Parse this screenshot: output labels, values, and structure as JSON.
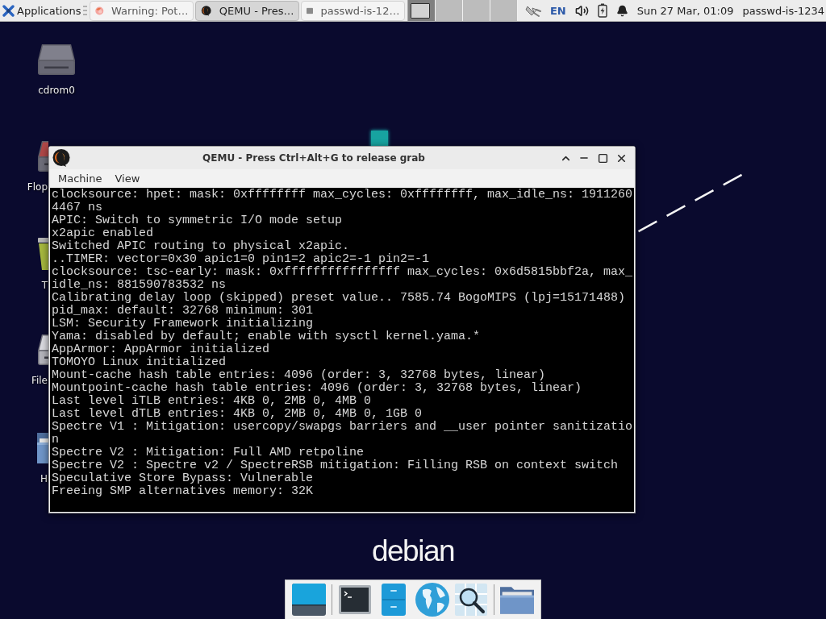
{
  "top_panel": {
    "applications_menu": {
      "label": "Applications"
    },
    "tasks": [
      {
        "kind": "browser",
        "label": "Warning: Pot…",
        "selected": false
      },
      {
        "kind": "qemu",
        "label": "QEMU - Pres…",
        "selected": true
      },
      {
        "kind": "terminal",
        "label": "passwd-is-12…",
        "selected": false
      }
    ],
    "workspaces": [
      {
        "selected": true,
        "has_window": true
      },
      {
        "selected": false,
        "has_window": false
      },
      {
        "selected": false,
        "has_window": false
      },
      {
        "selected": false,
        "has_window": false
      }
    ],
    "tray": [
      {
        "kind": "network"
      },
      {
        "kind": "keyboard-layout",
        "label": "EN"
      },
      {
        "kind": "volume"
      },
      {
        "kind": "battery"
      },
      {
        "kind": "notifications"
      },
      {
        "kind": "clock",
        "label": "Sun 27 Mar, 01:09"
      },
      {
        "kind": "user",
        "label": "passwd-is-1234"
      }
    ]
  },
  "desktop_icons": [
    {
      "kind": "optical-drive",
      "label": "cdrom0"
    },
    {
      "kind": "floppy",
      "label": "Flop"
    },
    {
      "kind": "trash",
      "label": "T"
    },
    {
      "kind": "drive",
      "label": "File"
    },
    {
      "kind": "home",
      "label": "H"
    }
  ],
  "qemu_window": {
    "title": "QEMU - Press Ctrl+Alt+G to release grab",
    "menu": [
      "Machine",
      "View"
    ],
    "console_lines": [
      "clocksource: hpet: mask: 0xffffffff max_cycles: 0xffffffff, max_idle_ns: 1911260",
      "4467 ns",
      "APIC: Switch to symmetric I/O mode setup",
      "x2apic enabled",
      "Switched APIC routing to physical x2apic.",
      "..TIMER: vector=0x30 apic1=0 pin1=2 apic2=-1 pin2=-1",
      "clocksource: tsc-early: mask: 0xffffffffffffffff max_cycles: 0x6d5815bbf2a, max_",
      "idle_ns: 881590783532 ns",
      "Calibrating delay loop (skipped) preset value.. 7585.74 BogoMIPS (lpj=15171488)",
      "pid_max: default: 32768 minimum: 301",
      "LSM: Security Framework initializing",
      "Yama: disabled by default; enable with sysctl kernel.yama.*",
      "AppArmor: AppArmor initialized",
      "TOMOYO Linux initialized",
      "Mount-cache hash table entries: 4096 (order: 3, 32768 bytes, linear)",
      "Mountpoint-cache hash table entries: 4096 (order: 3, 32768 bytes, linear)",
      "Last level iTLB entries: 4KB 0, 2MB 0, 4MB 0",
      "Last level dTLB entries: 4KB 0, 2MB 0, 4MB 0, 1GB 0",
      "Spectre V1 : Mitigation: usercopy/swapgs barriers and __user pointer sanitizatio",
      "n",
      "Spectre V2 : Mitigation: Full AMD retpoline",
      "Spectre V2 : Spectre v2 / SpectreRSB mitigation: Filling RSB on context switch",
      "Speculative Store Bypass: Vulnerable",
      "Freeing SMP alternatives memory: 32K"
    ]
  },
  "wallpaper": {
    "logo": "debian"
  },
  "dock": {
    "items": [
      {
        "kind": "show-desktop"
      },
      {
        "kind": "separator"
      },
      {
        "kind": "terminal"
      },
      {
        "kind": "file-manager"
      },
      {
        "kind": "web-browser"
      },
      {
        "kind": "app-finder"
      },
      {
        "kind": "separator"
      },
      {
        "kind": "folder"
      }
    ]
  }
}
